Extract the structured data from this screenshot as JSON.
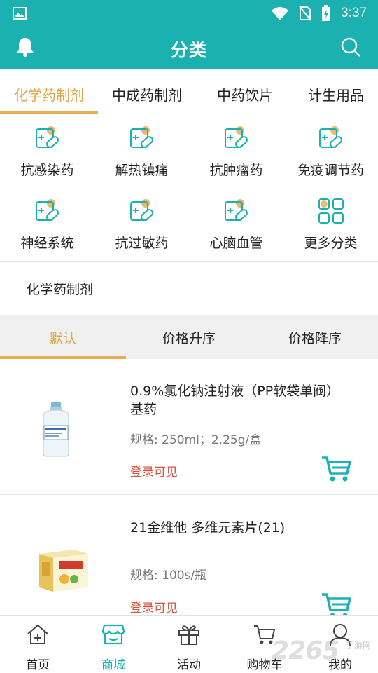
{
  "status_bar": {
    "time": "3:37"
  },
  "header": {
    "title": "分类"
  },
  "category_tabs": [
    {
      "label": "化学药制剂",
      "active": true
    },
    {
      "label": "中成药制剂",
      "active": false
    },
    {
      "label": "中药饮片",
      "active": false
    },
    {
      "label": "计生用品",
      "active": false
    }
  ],
  "subcategories": [
    {
      "label": "抗感染药",
      "icon": "medicine-icon"
    },
    {
      "label": "解热镇痛",
      "icon": "medicine-icon"
    },
    {
      "label": "抗肿瘤药",
      "icon": "medicine-icon"
    },
    {
      "label": "免疫调节药",
      "icon": "medicine-icon"
    },
    {
      "label": "神经系统",
      "icon": "medicine-icon"
    },
    {
      "label": "抗过敏药",
      "icon": "medicine-icon"
    },
    {
      "label": "心脑血管",
      "icon": "medicine-icon"
    },
    {
      "label": "更多分类",
      "icon": "grid-icon"
    }
  ],
  "section_title": "化学药制剂",
  "sort_options": [
    {
      "label": "默认",
      "active": true
    },
    {
      "label": "价格升序",
      "active": false
    },
    {
      "label": "价格降序",
      "active": false
    }
  ],
  "products": [
    {
      "name": "0.9%氯化钠注射液（PP软袋单阀）基药",
      "spec": "规格: 250ml；2.25g/盒",
      "price_text": "登录可见"
    },
    {
      "name": "21金维他 多维元素片(21)",
      "spec": "规格: 100s/瓶",
      "price_text": "登录可见"
    }
  ],
  "bottom_nav": [
    {
      "label": "首页",
      "icon": "home-icon",
      "active": false
    },
    {
      "label": "商城",
      "icon": "store-icon",
      "active": true
    },
    {
      "label": "活动",
      "icon": "gift-icon",
      "active": false
    },
    {
      "label": "购物车",
      "icon": "cart-icon",
      "active": false
    },
    {
      "label": "我的",
      "icon": "user-icon",
      "active": false
    }
  ],
  "watermark": {
    "main": "2265",
    "sub": "手游网"
  },
  "colors": {
    "primary": "#1bb1b0",
    "accent": "#e7ad4e",
    "price": "#d2553e"
  }
}
